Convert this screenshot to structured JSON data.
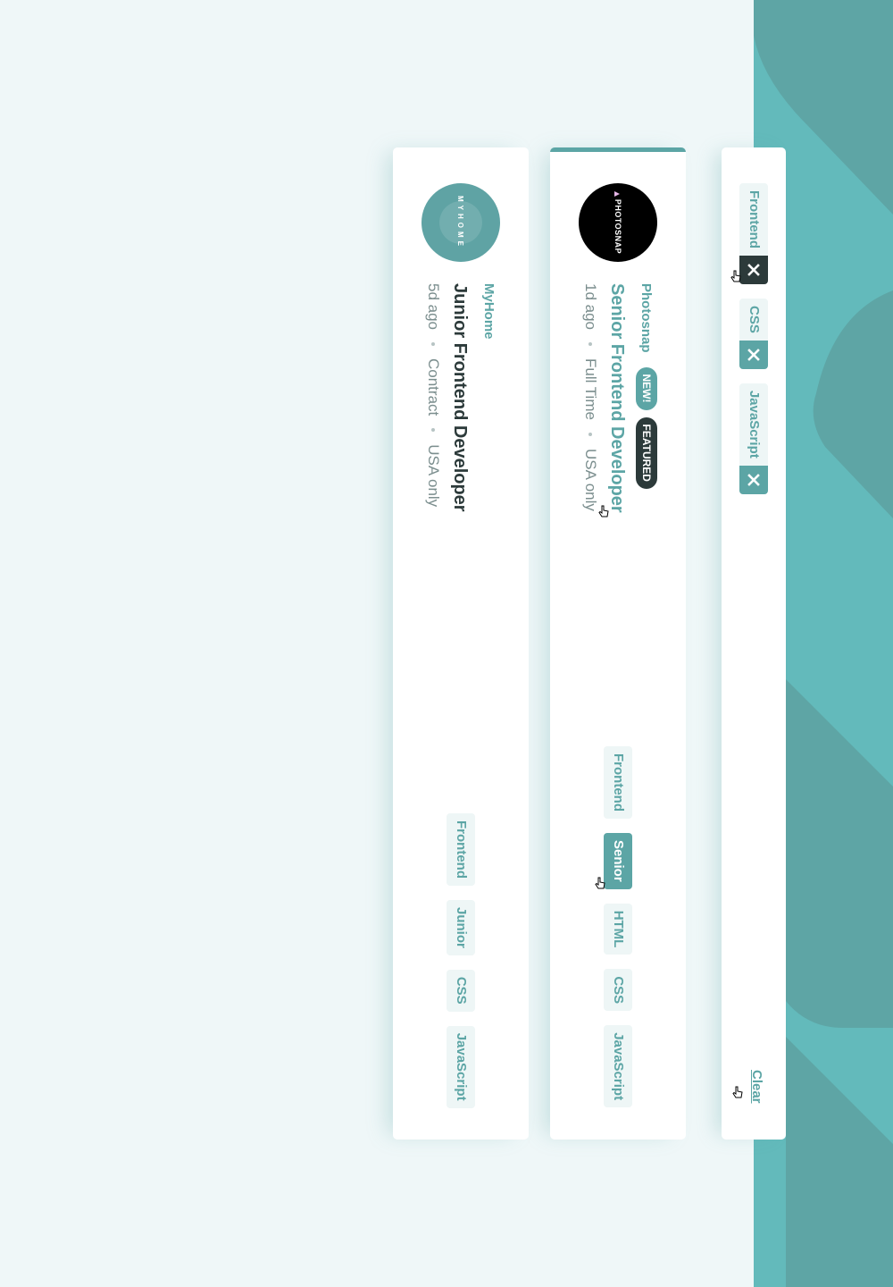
{
  "colors": {
    "accent": "#5ca5a5",
    "header_band": "#63babb",
    "page_background": "#eff7f8",
    "dark": "#2c3a3a",
    "muted_text": "#7b8e8e"
  },
  "filters": {
    "tags": [
      {
        "label": "Frontend",
        "remove_icon": "close-icon"
      },
      {
        "label": "CSS",
        "remove_icon": "close-icon"
      },
      {
        "label": "JavaScript",
        "remove_icon": "close-icon"
      }
    ],
    "clear_label": "Clear"
  },
  "jobs": [
    {
      "company": "Photosnap",
      "logo_text": "PHOTOSNAP",
      "new_badge": "NEW!",
      "featured_badge": "FEATURED",
      "position": "Senior Frontend Developer",
      "posted": "1d ago",
      "contract": "Full Time",
      "location": "USA only",
      "tags": [
        "Frontend",
        "Senior",
        "HTML",
        "CSS",
        "JavaScript"
      ]
    },
    {
      "company": "MyHome",
      "logo_text": "MYHOME",
      "position": "Junior Frontend Developer",
      "posted": "5d ago",
      "contract": "Contract",
      "location": "USA only",
      "tags": [
        "Frontend",
        "Junior",
        "CSS",
        "JavaScript"
      ]
    }
  ]
}
